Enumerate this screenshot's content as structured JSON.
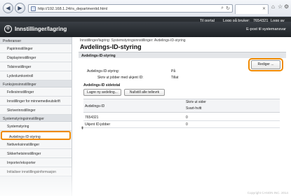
{
  "browser": {
    "back_icon": "back-arrow-icon",
    "forward_icon": "forward-arrow-icon",
    "url": "http://192.168.1.24/rs_departmentid.html",
    "tab_title": "",
    "toolbar_icons": [
      "home-icon",
      "star-icon",
      "gear-icon"
    ]
  },
  "header": {
    "portal_link": "Til portal",
    "logout_link": "Logg på bruker:",
    "user_id": "7654321",
    "logout_button": "Logg av",
    "app_title": "Innstillinger/lagring",
    "email_link": "E-post til systemansvar"
  },
  "sidebar": {
    "sections": [
      {
        "title": "Preferanser",
        "items": [
          "Papirinnstillinger",
          "Displayinnstillinger",
          "Tidsinnstillinger",
          "Lydvolumkontroll"
        ]
      },
      {
        "title": "Funksjonsinnstillinger",
        "items": [
          "Fellesinnstillinger",
          "Innstillinger for minnemedieutskrift",
          "Skriverinnstillinger"
        ]
      },
      {
        "title": "Systemstyringsinnstillinger",
        "items": [
          "Systemstyring",
          "Avdelings-ID-styring",
          "Nettverksinnstillinger",
          "Sikkerhetsinnstillinger",
          "Importer/eksporter",
          "Initialiser innstillingsinformasjon"
        ]
      }
    ],
    "active_item": "Avdelings-ID-styring"
  },
  "main": {
    "breadcrumb": "Innstillinger/lagring: Systemstyringsinnstillinger: Avdelings-ID-styring",
    "page_title": "Avdelings-ID-styring",
    "section_title": "Avdelings-ID-styring",
    "edit_button": "Rediger ...",
    "fields": [
      {
        "label": "Avdelings-ID-styring:",
        "value": "På"
      },
      {
        "label": "Skriv ut jobber med ukjent ID:",
        "value": "Tillat"
      }
    ],
    "page_subtitle": "Avdelings-ID sidetotal",
    "register_button": "Lagre ny avdeling...",
    "reset_button": "Nullstill alle tellevrk",
    "table": {
      "headers": [
        "Avdelings-ID",
        "Skriv ut sider"
      ],
      "subheader": "Svart-hvitt",
      "rows": [
        [
          "7654321",
          "0"
        ],
        [
          "Ukjent ID-jobber",
          "0"
        ]
      ]
    },
    "top_icon": "to-top-arrow-icon"
  },
  "footer": {
    "copyright": "Copyright CANON INC. 2014"
  }
}
